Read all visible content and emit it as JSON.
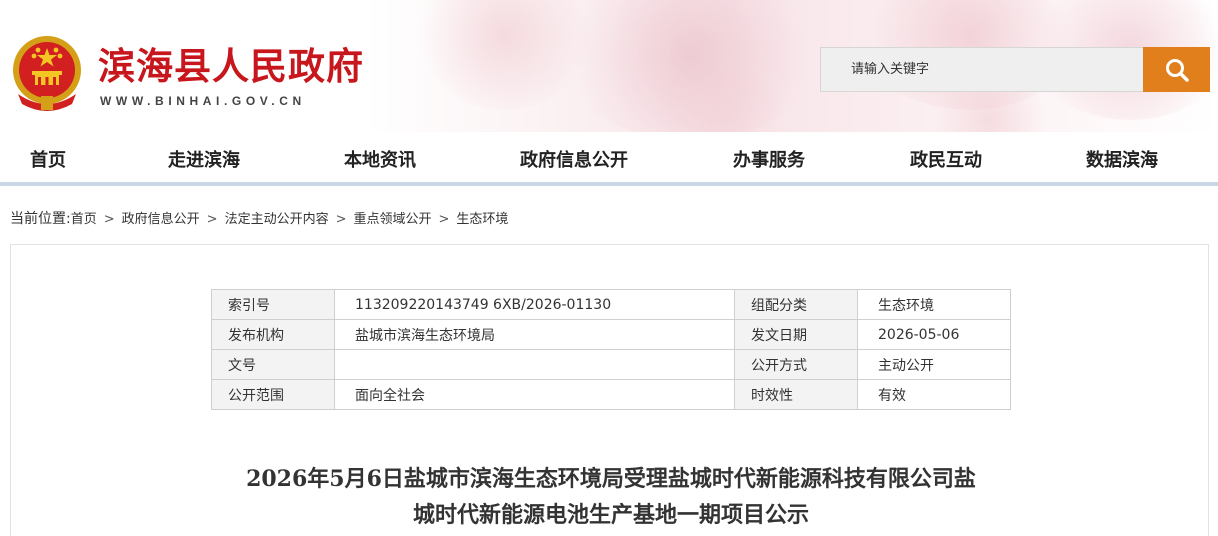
{
  "header": {
    "site_title": "滨海县人民政府",
    "site_domain": "WWW.BINHAI.GOV.CN",
    "emblem_icon": "national-emblem-icon",
    "search": {
      "placeholder": "请输入关键字",
      "button_icon": "search-icon"
    },
    "colors": {
      "title_red": "#c8161d",
      "search_orange": "#e07f1b"
    }
  },
  "nav": {
    "items": [
      "首页",
      "走进滨海",
      "本地资讯",
      "政府信息公开",
      "办事服务",
      "政民互动",
      "数据滨海"
    ]
  },
  "breadcrumb": {
    "lead": "当前位置:",
    "items": [
      "首页",
      "政府信息公开",
      "法定主动公开内容",
      "重点领域公开",
      "生态环境"
    ],
    "separator": ">"
  },
  "meta": {
    "rows": [
      {
        "k1": "索引号",
        "v1": "113209220143749 6XB/2026-01130",
        "k2": "组配分类",
        "v2": "生态环境"
      },
      {
        "k1": "发布机构",
        "v1": "盐城市滨海生态环境局",
        "k2": "发文日期",
        "v2": "2026-05-06"
      },
      {
        "k1": "文号",
        "v1": "",
        "k2": "公开方式",
        "v2": "主动公开"
      },
      {
        "k1": "公开范围",
        "v1": "面向全社会",
        "k2": "时效性",
        "v2": "有效"
      }
    ]
  },
  "document": {
    "title_line1": "2026年5月6日盐城市滨海生态环境局受理盐城时代新能源科技有限公司盐",
    "title_line2": "城时代新能源电池生产基地一期项目公示"
  }
}
